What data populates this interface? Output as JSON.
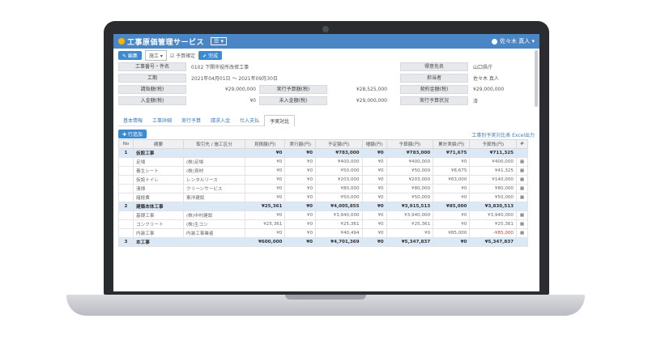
{
  "header": {
    "title": "工事原価管理サービス",
    "menu_label": "☰ ▾",
    "user": "佐々木 真人 ▾"
  },
  "toolbar": {
    "edit_label": "✎ 編集",
    "select_value": "施工 ▾",
    "status_text": "☑ 予算確定",
    "save_label": "✔ 完成"
  },
  "info_left": [
    {
      "label": "工事番号・件名",
      "value": "0102 下関市役所改修工事"
    },
    {
      "label": "工期",
      "value": "2021年04月01日 ～ 2021年09月30日"
    },
    {
      "label": "請負額(税)",
      "value": "¥29,000,000",
      "label2": "実行予算額(税)",
      "value2": "¥28,525,000"
    },
    {
      "label": "入金額(税)",
      "value": "¥0",
      "label2": "未入金額(税)",
      "value2": "¥29,000,000"
    }
  ],
  "info_right": [
    {
      "label": "得意先名",
      "value": "山口県庁"
    },
    {
      "label": "担当者",
      "value": "佐々木 真人"
    },
    {
      "label": "契約金額(税)",
      "value": "¥29,000,000"
    },
    {
      "label": "実行予算状況",
      "value": "済"
    }
  ],
  "tabs": [
    "基本情報",
    "工事詳細",
    "実行予算",
    "請求入金",
    "仕入支払",
    "予実対比"
  ],
  "active_tab": 5,
  "add_label": "✚ 行追加",
  "export_link": "工事別予実対比表 Excel出力",
  "table": {
    "columns": [
      "No",
      "摘要",
      "取引先 / 施工区分",
      "見積額(円)",
      "実行額(円)",
      "予定額(円)",
      "増額(円)",
      "予算額(円)",
      "累計実績(円)",
      "予算残(円)",
      "#"
    ],
    "rows": [
      {
        "group": true,
        "cells": [
          "1",
          "仮設工事",
          "",
          "¥0",
          "¥0",
          "¥783,000",
          "¥0",
          "¥783,000",
          "¥71,675",
          "¥711,325",
          ""
        ]
      },
      {
        "group": false,
        "cells": [
          "",
          "足場",
          "(株)足場",
          "¥0",
          "¥0",
          "¥400,000",
          "¥0",
          "¥400,000",
          "¥0",
          "¥400,000",
          "▦"
        ]
      },
      {
        "group": false,
        "cells": [
          "",
          "養生シート",
          "(株)資材",
          "¥0",
          "¥0",
          "¥50,000",
          "¥0",
          "¥50,000",
          "¥8,675",
          "¥41,325",
          "▦"
        ]
      },
      {
        "group": false,
        "cells": [
          "",
          "仮設トイレ",
          "レンタルリース",
          "¥0",
          "¥0",
          "¥203,000",
          "¥0",
          "¥203,000",
          "¥63,000",
          "¥140,000",
          "▦"
        ]
      },
      {
        "group": false,
        "cells": [
          "",
          "清掃",
          "クリーンサービス",
          "¥0",
          "¥0",
          "¥80,000",
          "¥0",
          "¥80,000",
          "¥0",
          "¥80,000",
          "▦"
        ]
      },
      {
        "group": false,
        "cells": [
          "",
          "諸経費",
          "東洋建設",
          "¥0",
          "¥0",
          "¥50,000",
          "¥0",
          "¥50,000",
          "¥0",
          "¥50,000",
          "▦"
        ]
      },
      {
        "group": true,
        "cells": [
          "2",
          "建築本体工事",
          "",
          "¥25,361",
          "¥0",
          "¥4,005,855",
          "¥0",
          "¥3,915,513",
          "¥85,000",
          "¥3,830,513",
          ""
        ]
      },
      {
        "group": false,
        "cells": [
          "",
          "基礎工事",
          "(株)中村建設",
          "¥0",
          "¥0",
          "¥3,940,000",
          "¥0",
          "¥3,940,000",
          "¥0",
          "¥3,940,000",
          "▦"
        ]
      },
      {
        "group": false,
        "cells": [
          "",
          "コンクリート",
          "(株)生コン",
          "¥25,361",
          "¥0",
          "¥25,361",
          "¥0",
          "¥25,361",
          "¥0",
          "¥25,361",
          "▦"
        ]
      },
      {
        "group": false,
        "cells": [
          "",
          "内装工事",
          "内装工事業者",
          "¥0",
          "¥0",
          "¥40,494",
          "¥0",
          "¥0",
          "¥85,000",
          "-¥85,000",
          "▦"
        ]
      },
      {
        "group": true,
        "cells": [
          "3",
          "本工事",
          "",
          "¥600,000",
          "¥0",
          "¥4,701,369",
          "¥0",
          "¥5,347,837",
          "¥0",
          "¥5,347,837",
          ""
        ]
      }
    ]
  }
}
